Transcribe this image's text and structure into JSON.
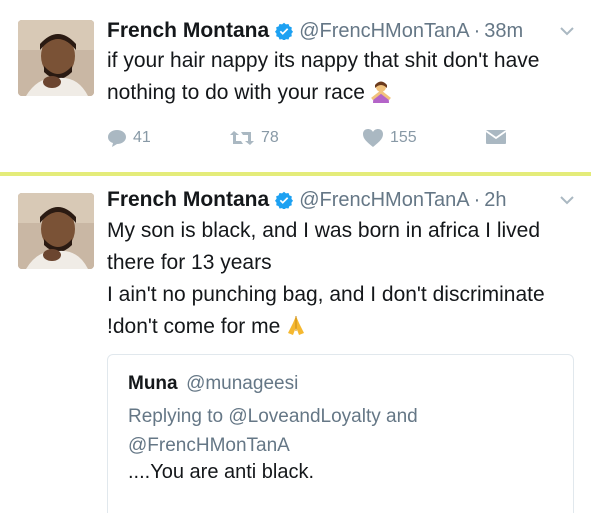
{
  "colors": {
    "accent": "#1da1f2",
    "separator": "#e4ec7a",
    "muted": "#657786",
    "icon": "#8899a6"
  },
  "tweets": [
    {
      "name": "French Montana",
      "handle": "@FrencHMonTanA",
      "dot": "·",
      "time": "38m",
      "text": "if your hair nappy its nappy that shit don't have nothing to do with your race",
      "emoji": "person-gesturing-no",
      "replies": "41",
      "retweets": "78",
      "likes": "155"
    },
    {
      "name": "French Montana",
      "handle": "@FrencHMonTanA",
      "dot": "·",
      "time": "2h",
      "line1": "My son is black, and I was born in africa I lived there for 13 years",
      "line2": "I ain't no punching bag, and I don't discriminate !don't come for me",
      "emoji": "folded-hands",
      "quote": {
        "name": "Muna",
        "handle": "@munageesi",
        "replying": "Replying to @LoveandLoyalty and @FrencHMonTanA",
        "text": "....You are anti black."
      }
    }
  ]
}
